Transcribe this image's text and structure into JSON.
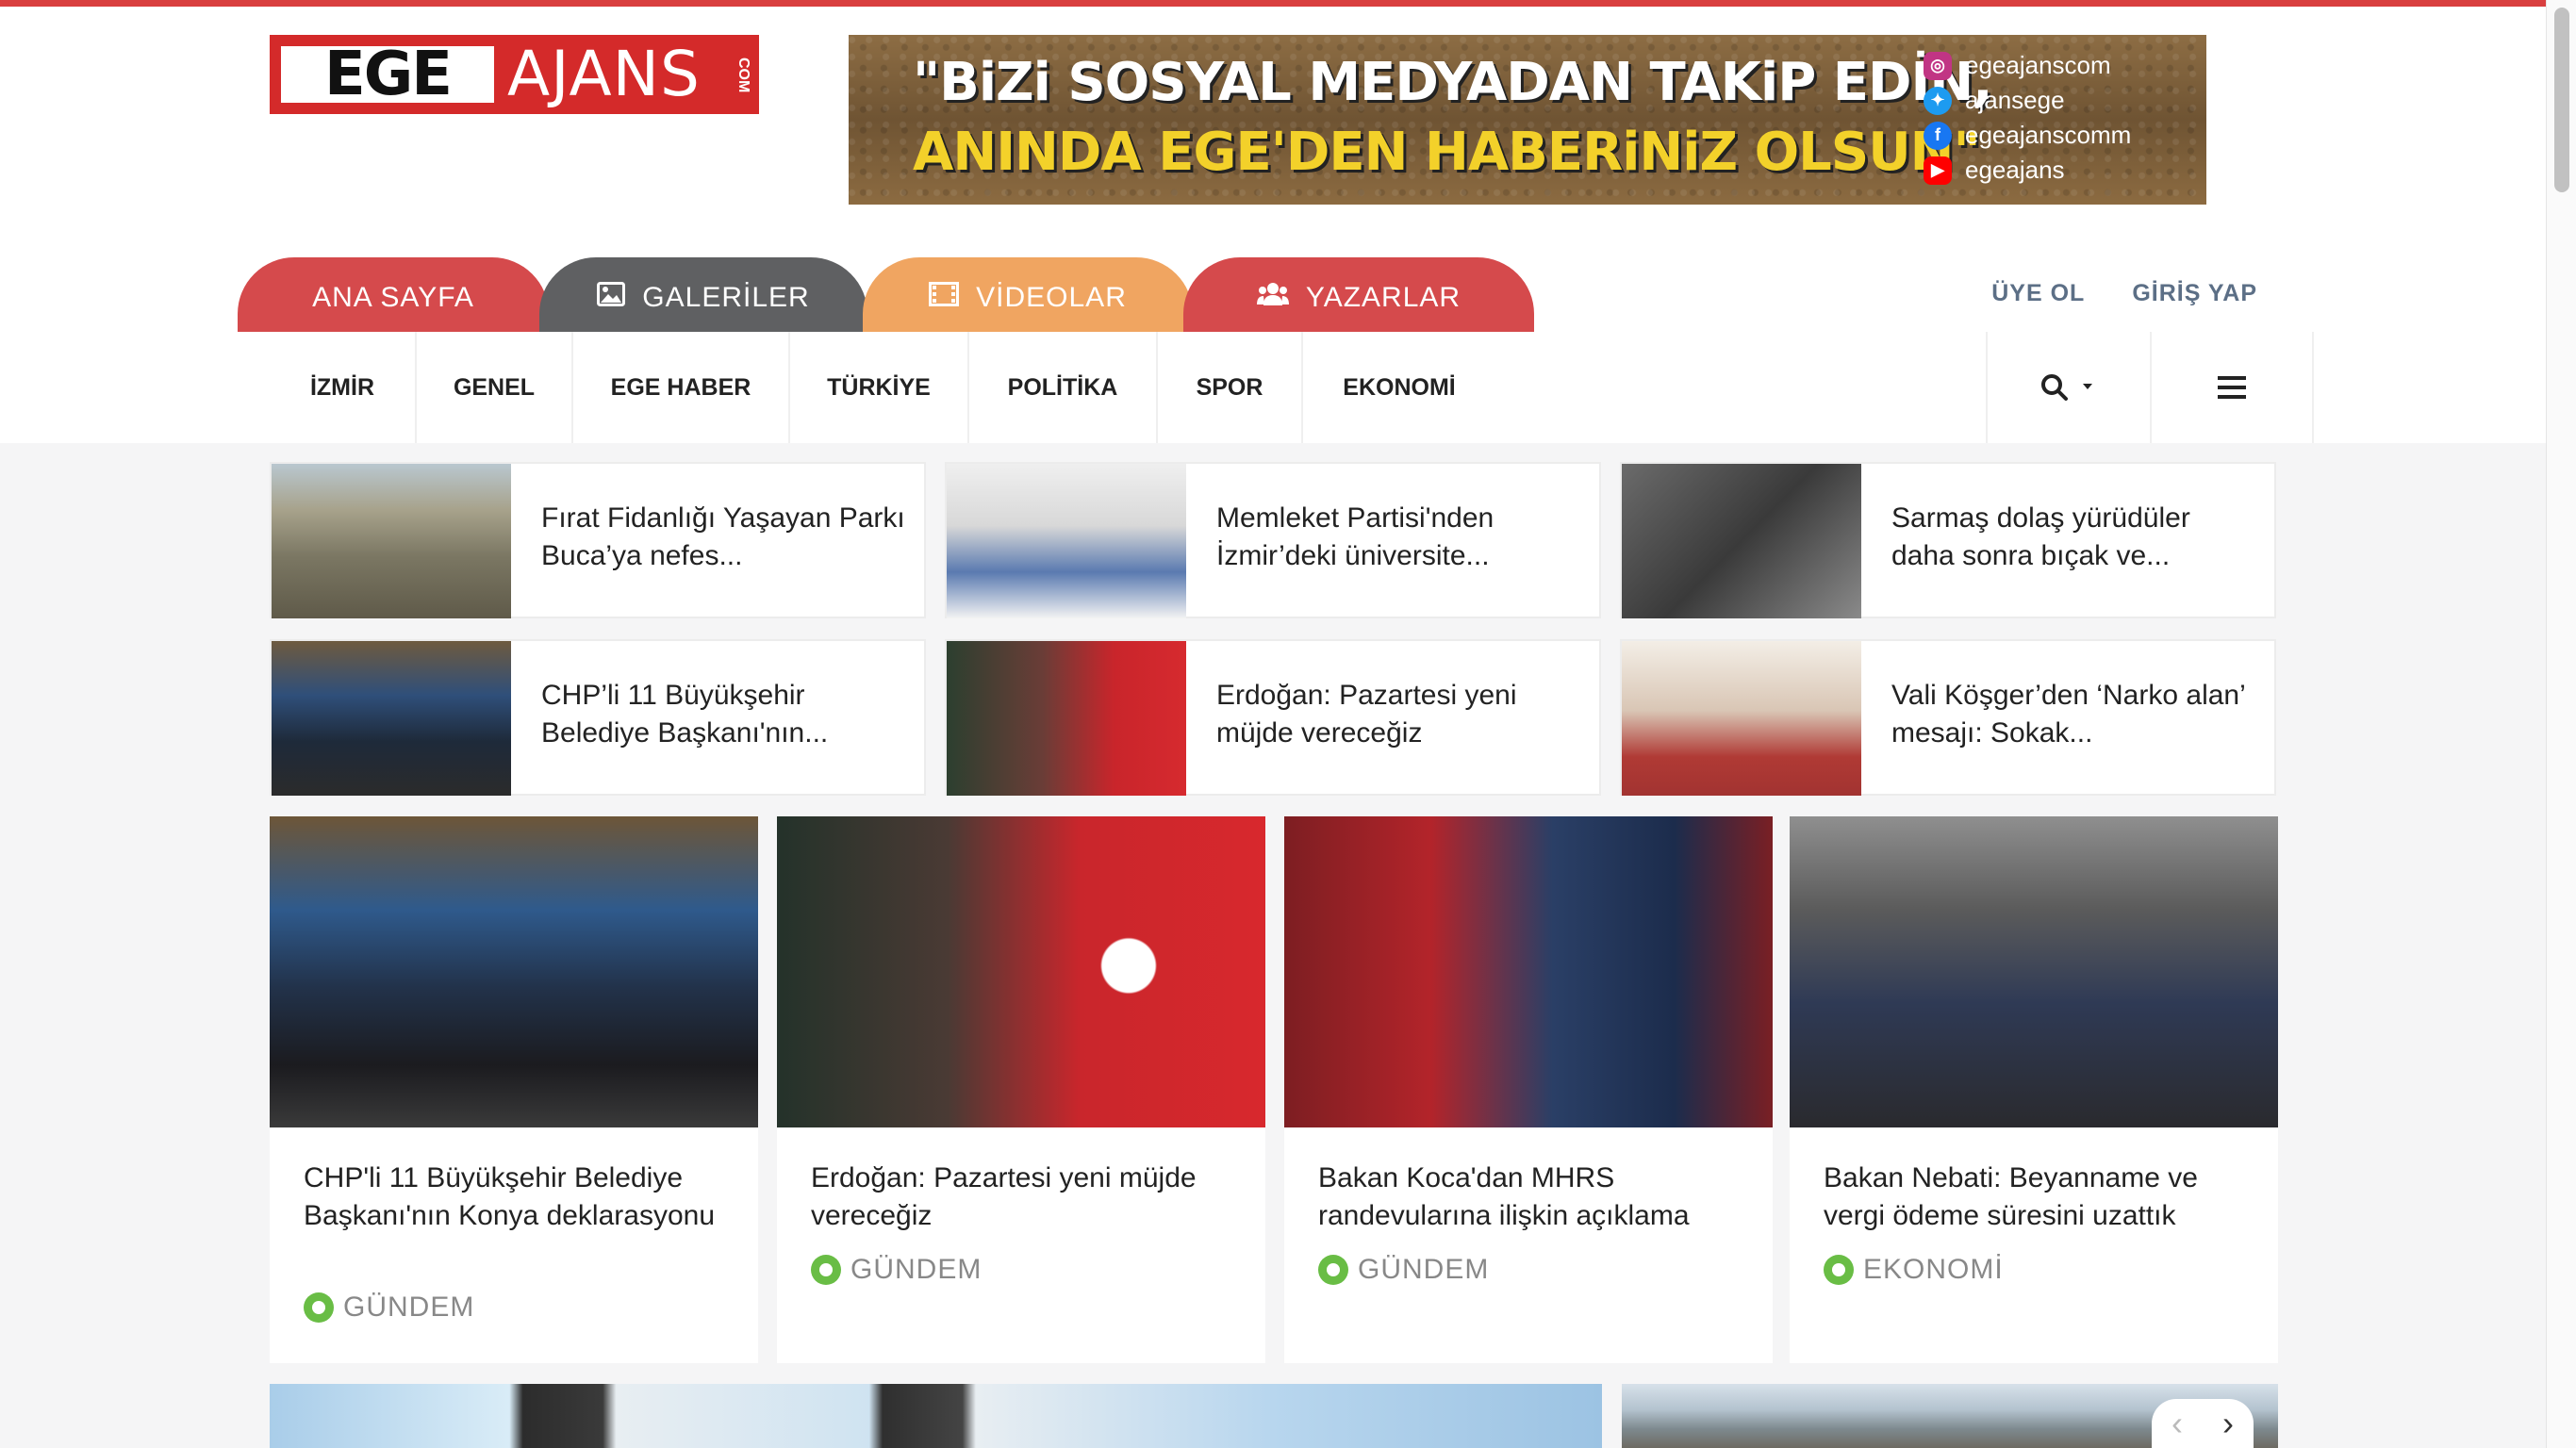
{
  "logo": {
    "ege": "EGE",
    "ajans": "AJANS",
    "dotcom": "COM"
  },
  "banner": {
    "line1": "\"BiZi SOSYAL MEDYADAN TAKiP EDİN,",
    "line2": "ANINDA EGE'DEN HABERiNiZ OLSUN\"",
    "social": [
      {
        "icon": "instagram-icon",
        "handle": "egeajanscom",
        "color": "#c13584"
      },
      {
        "icon": "twitter-icon",
        "handle": "ajansege",
        "color": "#1d9bf0"
      },
      {
        "icon": "facebook-icon",
        "handle": "egeajanscomm",
        "color": "#1877f2"
      },
      {
        "icon": "youtube-icon",
        "handle": "egeajans",
        "color": "#ff0000"
      }
    ]
  },
  "tabs": {
    "home": "ANA SAYFA",
    "galleries": "GALERİLER",
    "videos": "VİDEOLAR",
    "authors": "YAZARLAR"
  },
  "auth": {
    "register": "ÜYE OL",
    "login": "GİRİŞ YAP"
  },
  "categories": [
    "İZMİR",
    "GENEL",
    "EGE HABER",
    "TÜRKİYE",
    "POLİTİKA",
    "SPOR",
    "EKONOMİ"
  ],
  "small_news": [
    {
      "title": "Fırat Fidanlığı Yaşayan Parkı Buca’ya nefes..."
    },
    {
      "title": "Memleket Partisi'nden İzmir’deki üniversite..."
    },
    {
      "title": "Sarmaş dolaş yürüdüler daha sonra bıçak ve..."
    },
    {
      "title": "CHP’li 11 Büyükşehir Belediye Başkanı'nın..."
    },
    {
      "title": "Erdoğan: Pazartesi yeni müjde vereceğiz"
    },
    {
      "title": "Vali Köşger’den ‘Narko alan’ mesajı: Sokak..."
    }
  ],
  "big_news": [
    {
      "title": "CHP'li 11 Büyükşehir Belediye Başkanı'nın Konya deklarasyonu",
      "category": "GÜNDEM"
    },
    {
      "title": "Erdoğan: Pazartesi yeni müjde vereceğiz",
      "category": "GÜNDEM"
    },
    {
      "title": "Bakan Koca'dan MHRS randevularına ilişkin açıklama",
      "category": "GÜNDEM"
    },
    {
      "title": "Bakan Nebati: Beyanname ve vergi ödeme süresini uzattık",
      "category": "EKONOMİ"
    }
  ],
  "colors": {
    "brand_red": "#d54a4c",
    "gallery_gray": "#5f6062",
    "video_orange": "#f0a561",
    "tag_green": "#69bd45"
  }
}
